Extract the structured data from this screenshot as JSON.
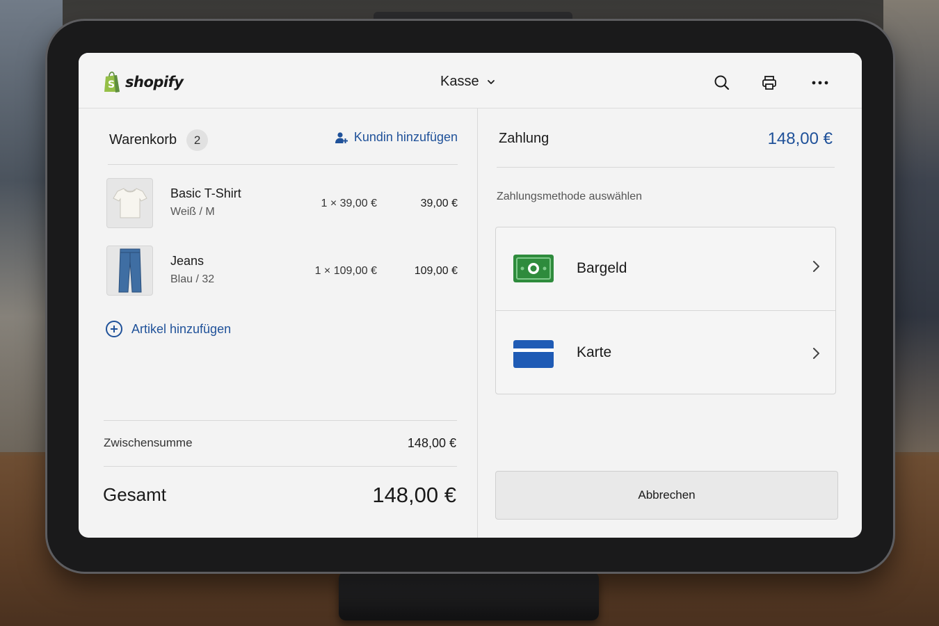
{
  "header": {
    "brand": "shopify",
    "location": "Kasse"
  },
  "cart": {
    "title": "Warenkorb",
    "count": "2",
    "add_customer": "Kundin hinzufügen",
    "items": [
      {
        "name": "Basic T-Shirt",
        "variant": "Weiß / M",
        "qty_price": "1 × 39,00 €",
        "total": "39,00 €"
      },
      {
        "name": "Jeans",
        "variant": "Blau / 32",
        "qty_price": "1 × 109,00 €",
        "total": "109,00 €"
      }
    ],
    "add_item": "Artikel hinzufügen",
    "subtotal_label": "Zwischensumme",
    "subtotal_value": "148,00 €",
    "total_label": "Gesamt",
    "total_value": "148,00 €"
  },
  "payment": {
    "title": "Zahlung",
    "amount": "148,00 €",
    "select_label": "Zahlungsmethode auswählen",
    "methods": [
      {
        "label": "Bargeld",
        "icon": "cash-icon"
      },
      {
        "label": "Karte",
        "icon": "card-icon"
      }
    ],
    "cancel": "Abbrechen"
  },
  "colors": {
    "accent": "#1f5199",
    "cash_green": "#2e8b3c",
    "card_blue": "#1f5bb5",
    "brand_green": "#5e8e3e"
  }
}
